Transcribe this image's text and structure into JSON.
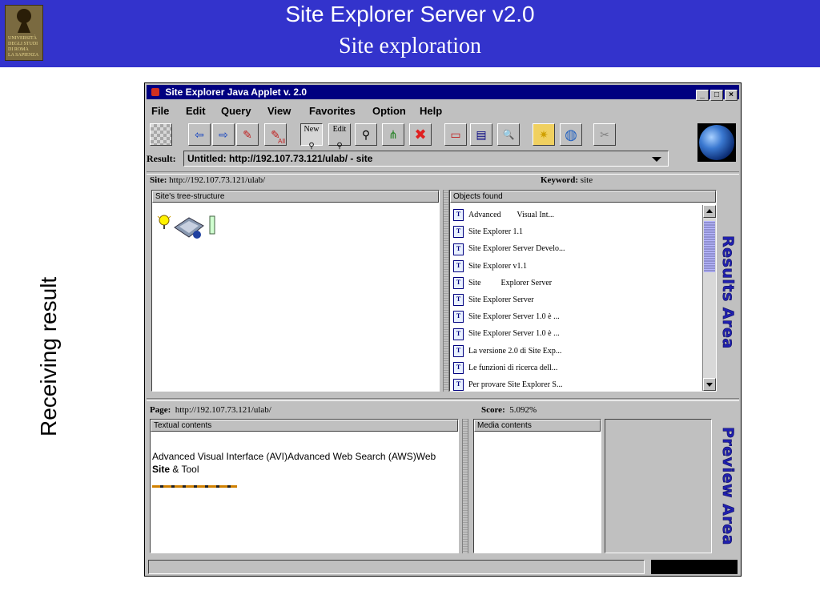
{
  "slide": {
    "title": "Site Explorer Server v2.0",
    "subtitle": "Site exploration",
    "side_caption": "Receiving result",
    "logo_text": [
      "UNIVERSITÀ",
      "DEGLI STUDI",
      "DI ROMA",
      "LA SAPIENZA"
    ]
  },
  "window": {
    "title": "Site Explorer Java Applet v. 2.0",
    "controls": [
      "_",
      "□",
      "×"
    ]
  },
  "menu": [
    "File",
    "Edit",
    "Query",
    "View",
    "Favorites",
    "Option",
    "Help"
  ],
  "toolbar": {
    "buttons": [
      {
        "name": "grid-icon",
        "glyph": "▦"
      },
      {
        "name": "back-arrow-icon",
        "glyph": "⇦"
      },
      {
        "name": "forward-arrow-icon",
        "glyph": "⇨"
      },
      {
        "name": "eraser-icon",
        "glyph": "✎"
      },
      {
        "name": "eraser-all-icon",
        "glyph": "✎",
        "badge": "All"
      },
      {
        "name": "new-query-icon",
        "label": "New"
      },
      {
        "name": "edit-query-icon",
        "label": "Edit"
      },
      {
        "name": "search-icon",
        "glyph": "⚲"
      },
      {
        "name": "tree-structure-icon",
        "glyph": "⋔"
      },
      {
        "name": "stop-icon",
        "glyph": "✖"
      },
      {
        "name": "window-layout-icon",
        "glyph": "▭"
      },
      {
        "name": "table-view-icon",
        "glyph": "▤"
      },
      {
        "name": "preview-zoom-icon",
        "glyph": "🔍"
      },
      {
        "name": "favorites-folder-icon",
        "glyph": "✷"
      },
      {
        "name": "globe-search-icon",
        "glyph": "◍"
      },
      {
        "name": "disabled-tool-icon",
        "glyph": "✂"
      }
    ]
  },
  "result": {
    "label": "Result:",
    "value": "Untitled: http://192.107.73.121/ulab/ - site"
  },
  "site_bar": {
    "site_label": "Site:",
    "site_value": "http://192.107.73.121/ulab/",
    "keyword_label": "Keyword:",
    "keyword_value": "site"
  },
  "tree_panel": {
    "header": "Site's tree-structure"
  },
  "objects_panel": {
    "header": "Objects found",
    "items": [
      "Advanced        Visual Int...",
      "Site Explorer 1.1",
      "Site Explorer Server Develo...",
      "Site Explorer v1.1",
      "Site          Explorer Server",
      "Site Explorer Server",
      "Site Explorer Server 1.0 è ...",
      "Site Explorer Server 1.0 è ...",
      "La versione 2.0 di Site Exp...",
      "Le funzioni di ricerca dell...",
      "Per provare Site Explorer S..."
    ]
  },
  "results_area_label": "Results Area",
  "page_bar": {
    "page_label": "Page:",
    "page_value": "http://192.107.73.121/ulab/",
    "score_label": "Score:",
    "score_value": "5.092%"
  },
  "textual_panel": {
    "header": "Textual contents",
    "text_before": "Advanced        Visual Interface (AVI)Advanced Web Search (AWS)Web ",
    "text_bold": "Site",
    "text_after": " & Tool"
  },
  "media_panel": {
    "header": "Media contents"
  },
  "preview_area_label": "Preview Area"
}
